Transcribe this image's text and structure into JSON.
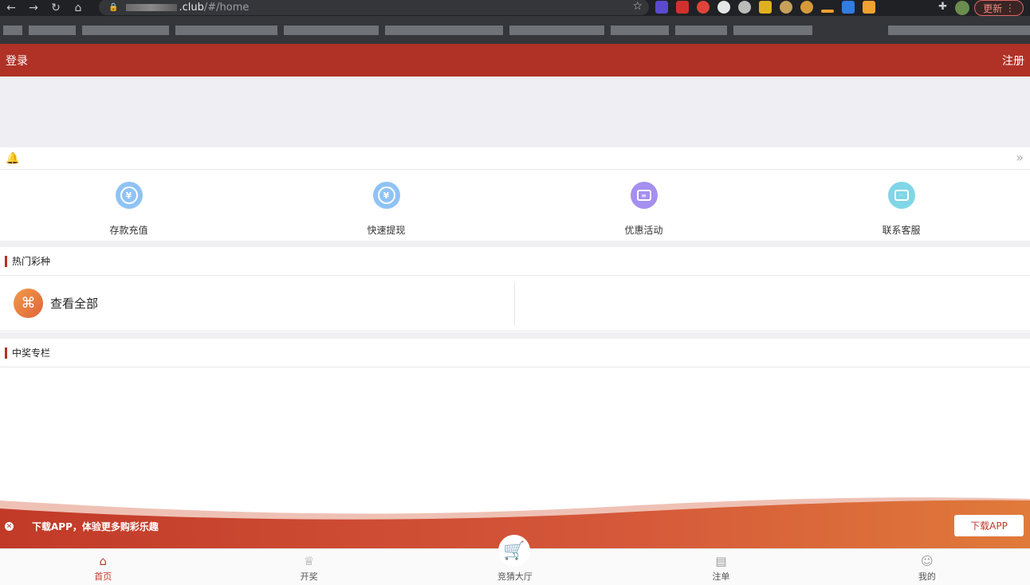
{
  "browser": {
    "url_host": ".club",
    "url_path": "/#/home",
    "update_label": "更新"
  },
  "header": {
    "login": "登录",
    "register": "注册"
  },
  "quick_actions": [
    {
      "label": "存款充值",
      "icon": "deposit-icon",
      "color": "#8fc3f5"
    },
    {
      "label": "快速提现",
      "icon": "withdraw-icon",
      "color": "#8fc3f5"
    },
    {
      "label": "优惠活动",
      "icon": "promo-icon",
      "color": "#a58ff0"
    },
    {
      "label": "联系客服",
      "icon": "support-icon",
      "color": "#7fd6e6"
    }
  ],
  "hot_section": {
    "title": "热门彩种",
    "view_all": "查看全部"
  },
  "winners_section": {
    "title": "中奖专栏"
  },
  "download": {
    "text": "下载APP，体验更多购彩乐趣",
    "button": "下载APP"
  },
  "tabs": [
    {
      "label": "首页",
      "icon": "home-icon"
    },
    {
      "label": "开奖",
      "icon": "trophy-icon"
    },
    {
      "label": "竞猜大厅",
      "icon": "cart-icon"
    },
    {
      "label": "注单",
      "icon": "clipboard-icon"
    },
    {
      "label": "我的",
      "icon": "user-icon"
    }
  ],
  "colors": {
    "brand": "#b03226",
    "accent_orange": "#e0643a"
  }
}
